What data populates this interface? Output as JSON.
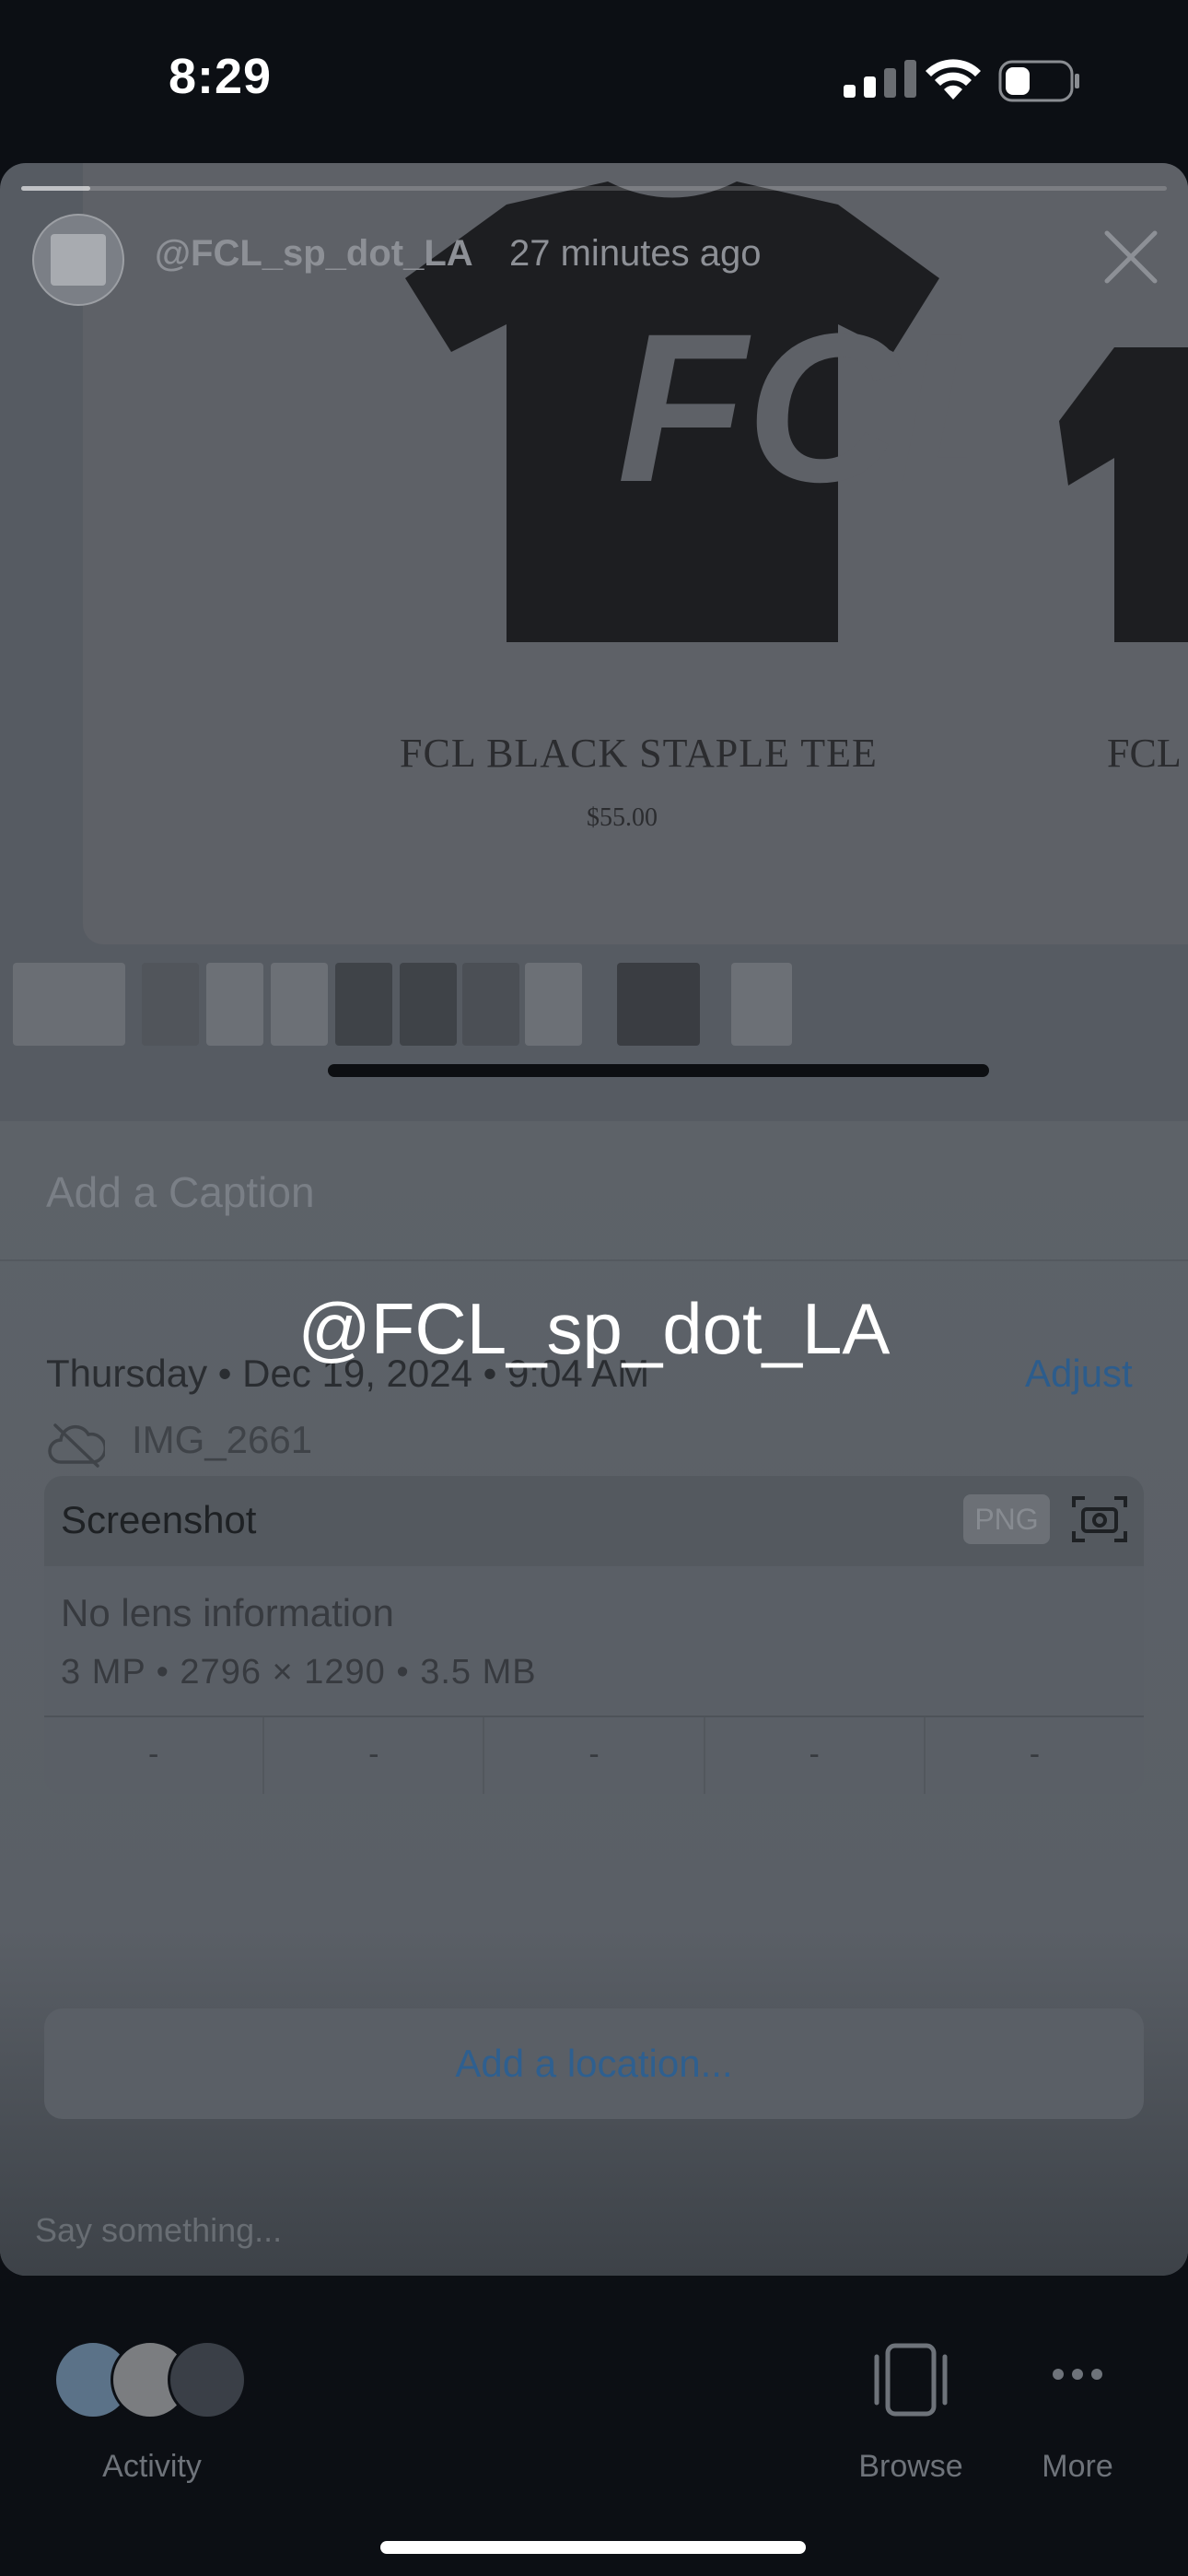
{
  "status_bar": {
    "time": "8:29"
  },
  "story": {
    "username": "@FCL_sp_dot_LA",
    "time_ago": "27 minutes ago",
    "progress": 0.06,
    "product": {
      "name": "FCL BLACK STAPLE TEE",
      "price": "$55.00",
      "next_name": "FCL"
    },
    "tee_logo": "FCL"
  },
  "info": {
    "caption_placeholder": "Add a Caption",
    "overlay_text": "@FCL_sp_dot_LA",
    "date_line": "Thursday • Dec 19, 2024 • 9:04 AM",
    "adjust_label": "Adjust",
    "filename": "IMG_2661",
    "meta": {
      "type": "Screenshot",
      "format_badge": "PNG",
      "lens": "No lens information",
      "specs": "3 MP • 2796 × 1290 • 3.5 MB",
      "exif": [
        "-",
        "-",
        "-",
        "-",
        "-"
      ]
    },
    "location_label": "Add a location...",
    "reply_placeholder": "Say something..."
  },
  "bottom_bar": {
    "activity_label": "Activity",
    "browse_label": "Browse",
    "more_label": "More"
  },
  "colors": {
    "accent_blue": "#2c5c8c",
    "background": "#0c0f14"
  }
}
